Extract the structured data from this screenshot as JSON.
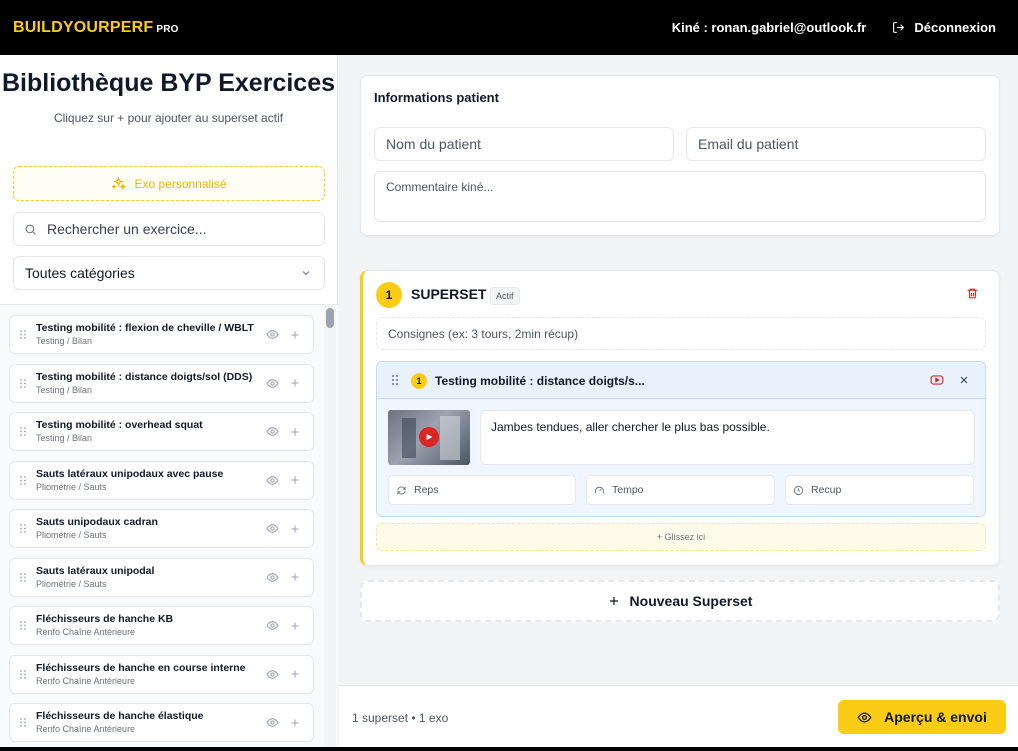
{
  "header": {
    "brand": "BUILDYOURPERF",
    "brand_badge": "PRO",
    "user_label": "Kiné : ronan.gabriel@outlook.fr",
    "logout_label": "Déconnexion"
  },
  "sidebar": {
    "title": "Bibliothèque BYP Exercices",
    "subtitle": "Cliquez sur + pour ajouter au superset actif",
    "custom_button": "Exo personnalisé",
    "search_placeholder": "Rechercher un exercice...",
    "category_select": "Toutes catégories",
    "exercises": [
      {
        "name": "Testing mobilité : flexion de cheville / WBLT",
        "category": "Testing / Bilan"
      },
      {
        "name": "Testing mobilité : distance doigts/sol (DDS)",
        "category": "Testing / Bilan"
      },
      {
        "name": "Testing mobilité : overhead squat",
        "category": "Testing / Bilan"
      },
      {
        "name": "Sauts latéraux unipodaux avec pause",
        "category": "Pliométrie / Sauts"
      },
      {
        "name": "Sauts unipodaux cadran",
        "category": "Pliométrie / Sauts"
      },
      {
        "name": "Sauts latéraux unipodal",
        "category": "Pliométrie / Sauts"
      },
      {
        "name": "Fléchisseurs de hanche KB",
        "category": "Renfo Chaîne Antérieure"
      },
      {
        "name": "Fléchisseurs de hanche en course interne",
        "category": "Renfo Chaîne Antérieure"
      },
      {
        "name": "Fléchisseurs de hanche élastique",
        "category": "Renfo Chaîne Antérieure"
      }
    ]
  },
  "patient": {
    "title": "Informations patient",
    "name_placeholder": "Nom du patient",
    "email_placeholder": "Email du patient",
    "comment_placeholder": "Commentaire kiné..."
  },
  "superset": {
    "number": "1",
    "title": "SUPERSET",
    "badge": "Actif",
    "consignes_placeholder": "Consignes (ex: 3 tours, 2min récup)",
    "exercise": {
      "number": "1",
      "title": "Testing mobilité : distance doigts/s...",
      "note": "Jambes tendues, aller chercher le plus bas possible.",
      "reps_placeholder": "Reps",
      "tempo_placeholder": "Tempo",
      "recup_placeholder": "Recup"
    },
    "dropzone": "+ Glissez ici"
  },
  "new_superset_label": "Nouveau Superset",
  "footer": {
    "summary": "1 superset • 1 exo",
    "send_button": "Aperçu & envoi"
  },
  "colors": {
    "accent": "#facc15",
    "header_bg": "#000000",
    "danger": "#dc2626"
  }
}
